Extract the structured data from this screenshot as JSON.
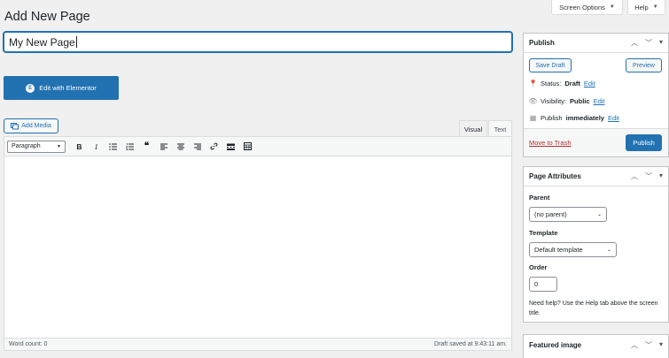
{
  "page_title": "Add New Page",
  "top_tabs": {
    "screen_options": "Screen Options",
    "help": "Help"
  },
  "title_value": "My New Page",
  "elementor_button": "Edit with Elementor",
  "add_media": "Add Media",
  "editor_tabs": {
    "visual": "Visual",
    "text": "Text"
  },
  "toolbar": {
    "format_select": "Paragraph"
  },
  "status": {
    "word_count": "Word count: 0",
    "draft_saved": "Draft saved at 9:43:11 am."
  },
  "publish_box": {
    "title": "Publish",
    "save_draft": "Save Draft",
    "preview": "Preview",
    "status_label": "Status:",
    "status_value": "Draft",
    "visibility_label": "Visibility:",
    "visibility_value": "Public",
    "publish_label": "Publish",
    "publish_value": "immediately",
    "edit": "Edit",
    "move_to_trash": "Move to Trash",
    "publish_button": "Publish"
  },
  "attributes_box": {
    "title": "Page Attributes",
    "parent_label": "Parent",
    "parent_value": "(no parent)",
    "template_label": "Template",
    "template_value": "Default template",
    "order_label": "Order",
    "order_value": "0",
    "help_text": "Need help? Use the Help tab above the screen title."
  },
  "featured_box": {
    "title": "Featured image"
  },
  "colors": {
    "accent": "#2271b1",
    "trash": "#b32d2e",
    "background": "#f0f0f1"
  }
}
